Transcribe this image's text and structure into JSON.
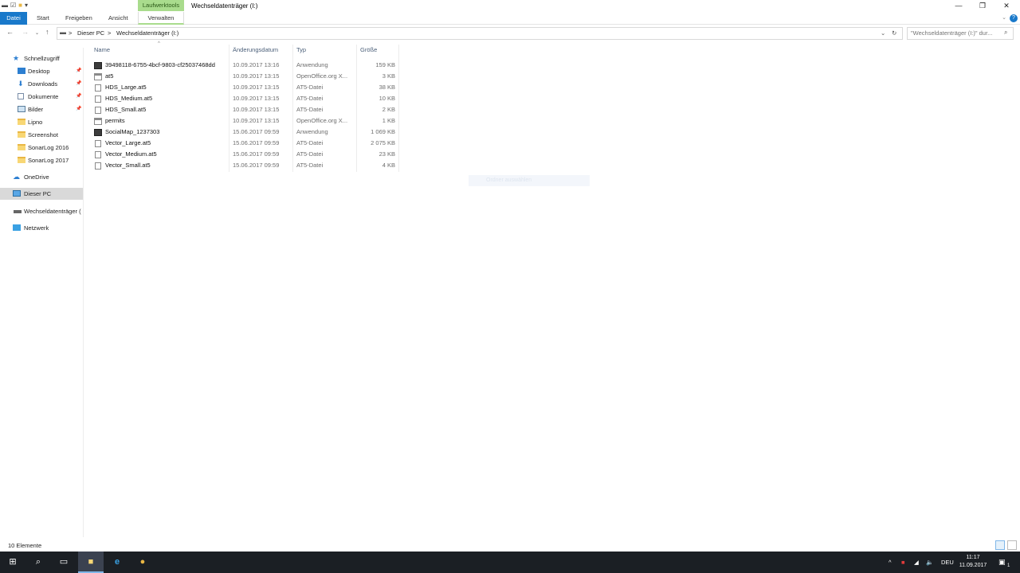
{
  "titlebar": {
    "context_tab": "Laufwerktools",
    "window_title": "Wechseldatenträger (I:)",
    "minimize": "—",
    "maximize": "❐",
    "close": "✕"
  },
  "ribbon": {
    "tabs": [
      {
        "label": "Datei"
      },
      {
        "label": "Start"
      },
      {
        "label": "Freigeben"
      },
      {
        "label": "Ansicht"
      },
      {
        "label": "Verwalten"
      }
    ],
    "help": "?"
  },
  "address": {
    "crumbs": [
      "Dieser PC",
      "Wechseldatenträger (I:)"
    ],
    "separator": ">"
  },
  "search": {
    "placeholder": "\"Wechseldatenträger (I:)\" dur..."
  },
  "navpane": {
    "quick_access": "Schnellzugriff",
    "pinned": [
      {
        "label": "Desktop"
      },
      {
        "label": "Downloads"
      },
      {
        "label": "Dokumente"
      },
      {
        "label": "Bilder"
      }
    ],
    "folders": [
      {
        "label": "Lipno"
      },
      {
        "label": "Screenshot"
      },
      {
        "label": "SonarLog 2016"
      },
      {
        "label": "SonarLog 2017"
      }
    ],
    "onedrive": "OneDrive",
    "this_pc": "Dieser PC",
    "drive": "Wechseldatenträger (",
    "network": "Netzwerk"
  },
  "columns": {
    "name": "Name",
    "date": "Änderungsdatum",
    "type": "Typ",
    "size": "Größe"
  },
  "files": [
    {
      "name": "39498118-6755-4bcf-9803-cf25037468dd",
      "date": "10.09.2017 13:16",
      "type": "Anwendung",
      "size": "159 KB",
      "icon": "app"
    },
    {
      "name": "at5",
      "date": "10.09.2017 13:15",
      "type": "OpenOffice.org X...",
      "size": "3 KB",
      "icon": "oo"
    },
    {
      "name": "HDS_Large.at5",
      "date": "10.09.2017 13:15",
      "type": "AT5-Datei",
      "size": "38 KB",
      "icon": "doc"
    },
    {
      "name": "HDS_Medium.at5",
      "date": "10.09.2017 13:15",
      "type": "AT5-Datei",
      "size": "10 KB",
      "icon": "doc"
    },
    {
      "name": "HDS_Small.at5",
      "date": "10.09.2017 13:15",
      "type": "AT5-Datei",
      "size": "2 KB",
      "icon": "doc"
    },
    {
      "name": "permits",
      "date": "10.09.2017 13:15",
      "type": "OpenOffice.org X...",
      "size": "1 KB",
      "icon": "oo"
    },
    {
      "name": "SocialMap_1237303",
      "date": "15.06.2017 09:59",
      "type": "Anwendung",
      "size": "1 069 KB",
      "icon": "app"
    },
    {
      "name": "Vector_Large.at5",
      "date": "15.06.2017 09:59",
      "type": "AT5-Datei",
      "size": "2 075 KB",
      "icon": "doc"
    },
    {
      "name": "Vector_Medium.at5",
      "date": "15.06.2017 09:59",
      "type": "AT5-Datei",
      "size": "23 KB",
      "icon": "doc"
    },
    {
      "name": "Vector_Small.at5",
      "date": "15.06.2017 09:59",
      "type": "AT5-Datei",
      "size": "4 KB",
      "icon": "doc"
    }
  ],
  "ghost_text": "Ordner auswählen",
  "status": {
    "count": "10 Elemente"
  },
  "taskbar": {
    "language": "DEU",
    "time": "11:17",
    "date": "11.09.2017",
    "notifications": "1"
  },
  "colors": {
    "accent": "#1979ca",
    "context_tab": "#a9dc8d",
    "taskbar": "#1b1f24"
  }
}
